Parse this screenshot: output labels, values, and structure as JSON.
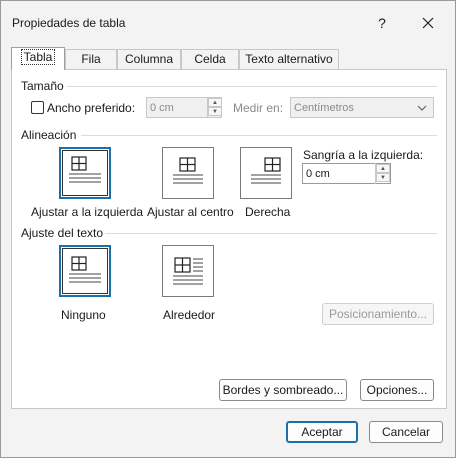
{
  "dialog": {
    "title": "Propiedades de tabla",
    "help_label": "?"
  },
  "tabs": [
    {
      "label": "Tabla"
    },
    {
      "label": "Fila"
    },
    {
      "label": "Columna"
    },
    {
      "label": "Celda"
    },
    {
      "label": "Texto alternativo"
    }
  ],
  "size": {
    "group_label": "Tamaño",
    "preferred_width_label": "Ancho preferido:",
    "preferred_width_value": "0 cm",
    "measure_label": "Medir en:",
    "measure_value": "Centímetros"
  },
  "alignment": {
    "group_label": "Alineación",
    "left_label": "Ajustar a la izquierda",
    "center_label": "Ajustar al centro",
    "right_label": "Derecha",
    "indent_label": "Sangría a la izquierda:",
    "indent_value": "0 cm"
  },
  "wrap": {
    "group_label": "Ajuste del texto",
    "none_label": "Ninguno",
    "around_label": "Alrededor",
    "positioning_button": "Posicionamiento..."
  },
  "buttons": {
    "borders": "Bordes y sombreado...",
    "options": "Opciones...",
    "accept": "Aceptar",
    "cancel": "Cancelar"
  },
  "colors": {
    "accent": "#1d6fa8"
  }
}
